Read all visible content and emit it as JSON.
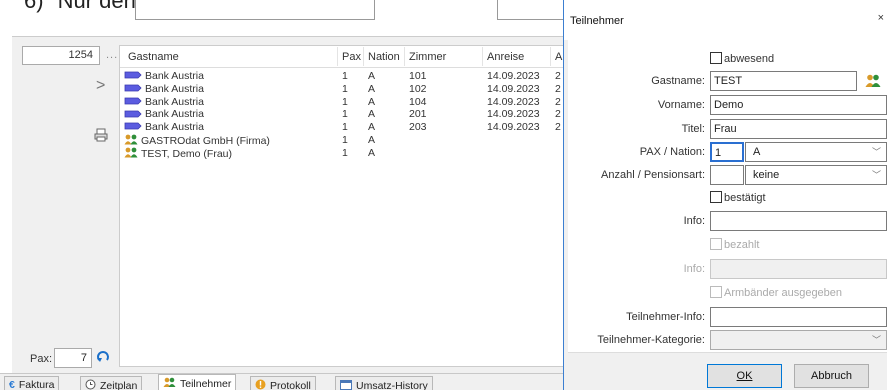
{
  "doc_heading": {
    "number": "6)",
    "text": "Nur den Namen eintragen"
  },
  "reservation": {
    "number": "1254",
    "dots": "...",
    "pax_label": "Pax:",
    "pax_value": "7"
  },
  "list": {
    "columns": [
      "Gastname",
      "Pax",
      "Nation",
      "Zimmer",
      "Anreise",
      "A"
    ],
    "rows": [
      {
        "icon": "tag-icon",
        "name": "Bank Austria",
        "pax": "1",
        "nation": "A",
        "room": "101",
        "arrival": "14.09.2023",
        "extra": "2"
      },
      {
        "icon": "tag-icon",
        "name": "Bank Austria",
        "pax": "1",
        "nation": "A",
        "room": "102",
        "arrival": "14.09.2023",
        "extra": "2"
      },
      {
        "icon": "tag-icon",
        "name": "Bank Austria",
        "pax": "1",
        "nation": "A",
        "room": "104",
        "arrival": "14.09.2023",
        "extra": "2"
      },
      {
        "icon": "tag-icon",
        "name": "Bank Austria",
        "pax": "1",
        "nation": "A",
        "room": "201",
        "arrival": "14.09.2023",
        "extra": "2"
      },
      {
        "icon": "tag-icon",
        "name": "Bank Austria",
        "pax": "1",
        "nation": "A",
        "room": "203",
        "arrival": "14.09.2023",
        "extra": "2"
      },
      {
        "icon": "people-icon",
        "name": "GASTROdat GmbH (Firma)",
        "pax": "1",
        "nation": "A",
        "room": "",
        "arrival": "",
        "extra": ""
      },
      {
        "icon": "people-icon",
        "name": "TEST, Demo (Frau)",
        "pax": "1",
        "nation": "A",
        "room": "",
        "arrival": "",
        "extra": ""
      }
    ]
  },
  "tabs": [
    "Faktura",
    "Zeitplan",
    "Teilnehmer",
    "Protokoll",
    "Umsatz-History"
  ],
  "active_tab": "Teilnehmer",
  "dialog": {
    "title": "Teilnehmer",
    "close": "×",
    "abwesend": "abwesend",
    "gastname_label": "Gastname:",
    "gastname": "TEST",
    "vorname_label": "Vorname:",
    "vorname": "Demo",
    "titel_label": "Titel:",
    "titel": "Frau",
    "pax_nation_label": "PAX / Nation:",
    "pax": "1",
    "nation": "A",
    "pension_label": "Anzahl / Pensionsart:",
    "pension_count": "",
    "pension": "keine",
    "bestaetigt": "bestätigt",
    "info_label": "Info:",
    "info": "",
    "bezahlt": "bezahlt",
    "info2_label": "Info:",
    "info2": "",
    "armbaender": "Armbänder ausgegeben",
    "teilnehmer_info_label": "Teilnehmer-Info:",
    "teilnehmer_info": "",
    "kategorie_label": "Teilnehmer-Kategorie:",
    "kategorie": "",
    "ok_label": "OK",
    "cancel_label": "Abbruch"
  }
}
